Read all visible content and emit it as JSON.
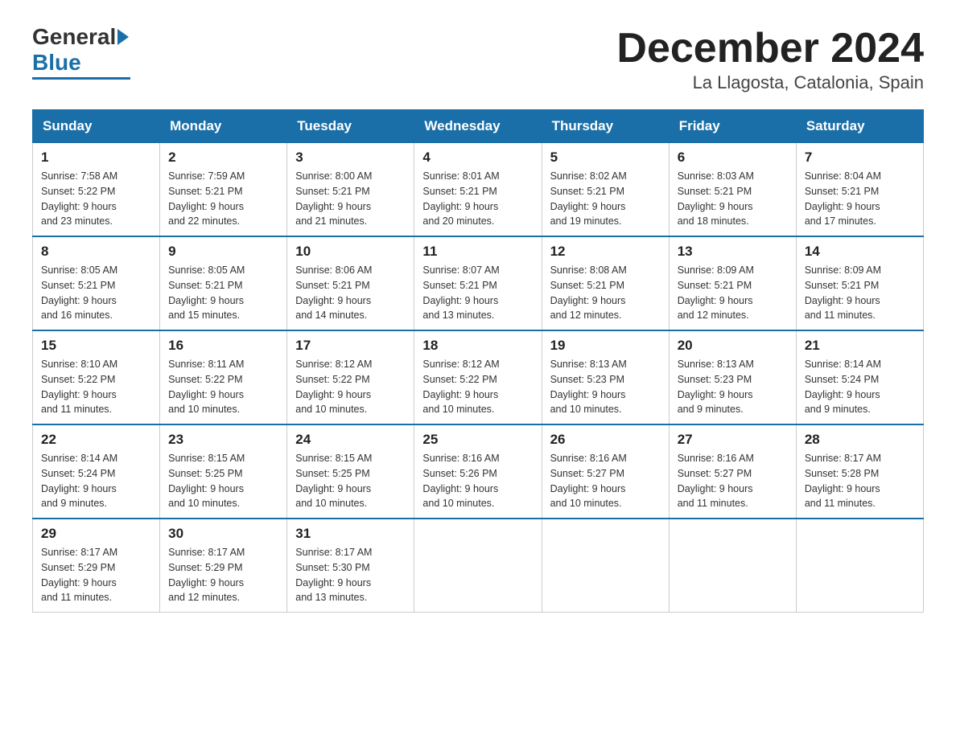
{
  "header": {
    "logo_general": "General",
    "logo_blue": "Blue",
    "month_title": "December 2024",
    "location": "La Llagosta, Catalonia, Spain"
  },
  "days_of_week": [
    "Sunday",
    "Monday",
    "Tuesday",
    "Wednesday",
    "Thursday",
    "Friday",
    "Saturday"
  ],
  "weeks": [
    [
      {
        "day": "1",
        "sunrise": "7:58 AM",
        "sunset": "5:22 PM",
        "daylight": "9 hours and 23 minutes."
      },
      {
        "day": "2",
        "sunrise": "7:59 AM",
        "sunset": "5:21 PM",
        "daylight": "9 hours and 22 minutes."
      },
      {
        "day": "3",
        "sunrise": "8:00 AM",
        "sunset": "5:21 PM",
        "daylight": "9 hours and 21 minutes."
      },
      {
        "day": "4",
        "sunrise": "8:01 AM",
        "sunset": "5:21 PM",
        "daylight": "9 hours and 20 minutes."
      },
      {
        "day": "5",
        "sunrise": "8:02 AM",
        "sunset": "5:21 PM",
        "daylight": "9 hours and 19 minutes."
      },
      {
        "day": "6",
        "sunrise": "8:03 AM",
        "sunset": "5:21 PM",
        "daylight": "9 hours and 18 minutes."
      },
      {
        "day": "7",
        "sunrise": "8:04 AM",
        "sunset": "5:21 PM",
        "daylight": "9 hours and 17 minutes."
      }
    ],
    [
      {
        "day": "8",
        "sunrise": "8:05 AM",
        "sunset": "5:21 PM",
        "daylight": "9 hours and 16 minutes."
      },
      {
        "day": "9",
        "sunrise": "8:05 AM",
        "sunset": "5:21 PM",
        "daylight": "9 hours and 15 minutes."
      },
      {
        "day": "10",
        "sunrise": "8:06 AM",
        "sunset": "5:21 PM",
        "daylight": "9 hours and 14 minutes."
      },
      {
        "day": "11",
        "sunrise": "8:07 AM",
        "sunset": "5:21 PM",
        "daylight": "9 hours and 13 minutes."
      },
      {
        "day": "12",
        "sunrise": "8:08 AM",
        "sunset": "5:21 PM",
        "daylight": "9 hours and 12 minutes."
      },
      {
        "day": "13",
        "sunrise": "8:09 AM",
        "sunset": "5:21 PM",
        "daylight": "9 hours and 12 minutes."
      },
      {
        "day": "14",
        "sunrise": "8:09 AM",
        "sunset": "5:21 PM",
        "daylight": "9 hours and 11 minutes."
      }
    ],
    [
      {
        "day": "15",
        "sunrise": "8:10 AM",
        "sunset": "5:22 PM",
        "daylight": "9 hours and 11 minutes."
      },
      {
        "day": "16",
        "sunrise": "8:11 AM",
        "sunset": "5:22 PM",
        "daylight": "9 hours and 10 minutes."
      },
      {
        "day": "17",
        "sunrise": "8:12 AM",
        "sunset": "5:22 PM",
        "daylight": "9 hours and 10 minutes."
      },
      {
        "day": "18",
        "sunrise": "8:12 AM",
        "sunset": "5:22 PM",
        "daylight": "9 hours and 10 minutes."
      },
      {
        "day": "19",
        "sunrise": "8:13 AM",
        "sunset": "5:23 PM",
        "daylight": "9 hours and 10 minutes."
      },
      {
        "day": "20",
        "sunrise": "8:13 AM",
        "sunset": "5:23 PM",
        "daylight": "9 hours and 9 minutes."
      },
      {
        "day": "21",
        "sunrise": "8:14 AM",
        "sunset": "5:24 PM",
        "daylight": "9 hours and 9 minutes."
      }
    ],
    [
      {
        "day": "22",
        "sunrise": "8:14 AM",
        "sunset": "5:24 PM",
        "daylight": "9 hours and 9 minutes."
      },
      {
        "day": "23",
        "sunrise": "8:15 AM",
        "sunset": "5:25 PM",
        "daylight": "9 hours and 10 minutes."
      },
      {
        "day": "24",
        "sunrise": "8:15 AM",
        "sunset": "5:25 PM",
        "daylight": "9 hours and 10 minutes."
      },
      {
        "day": "25",
        "sunrise": "8:16 AM",
        "sunset": "5:26 PM",
        "daylight": "9 hours and 10 minutes."
      },
      {
        "day": "26",
        "sunrise": "8:16 AM",
        "sunset": "5:27 PM",
        "daylight": "9 hours and 10 minutes."
      },
      {
        "day": "27",
        "sunrise": "8:16 AM",
        "sunset": "5:27 PM",
        "daylight": "9 hours and 11 minutes."
      },
      {
        "day": "28",
        "sunrise": "8:17 AM",
        "sunset": "5:28 PM",
        "daylight": "9 hours and 11 minutes."
      }
    ],
    [
      {
        "day": "29",
        "sunrise": "8:17 AM",
        "sunset": "5:29 PM",
        "daylight": "9 hours and 11 minutes."
      },
      {
        "day": "30",
        "sunrise": "8:17 AM",
        "sunset": "5:29 PM",
        "daylight": "9 hours and 12 minutes."
      },
      {
        "day": "31",
        "sunrise": "8:17 AM",
        "sunset": "5:30 PM",
        "daylight": "9 hours and 13 minutes."
      },
      null,
      null,
      null,
      null
    ]
  ]
}
